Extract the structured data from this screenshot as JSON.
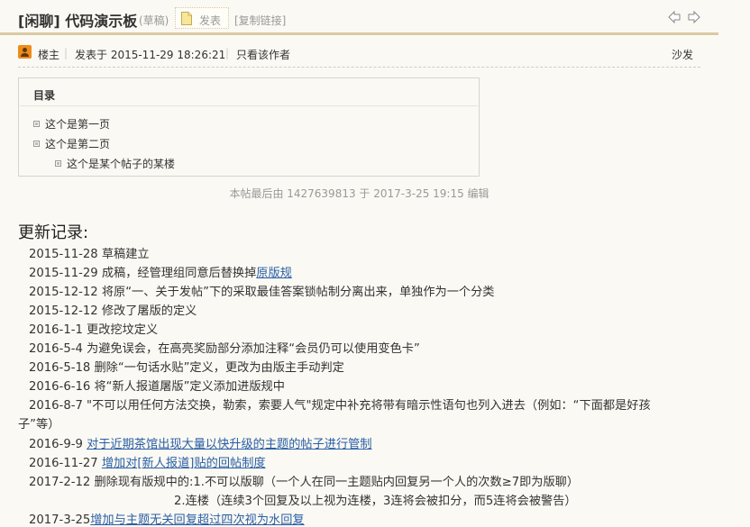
{
  "thread": {
    "title": "[闲聊] 代码演示板",
    "status": "(草稿)",
    "publish_label": "发表",
    "copy_link_label": "[复制链接]"
  },
  "post": {
    "author_role": "楼主",
    "sep": "|",
    "posted_at": "发表于 2015-11-29 18:26:21",
    "only_author": "只看该作者",
    "floor": "沙发"
  },
  "toc": {
    "title": "目录",
    "items": [
      {
        "label": "这个是第一页"
      },
      {
        "label": "这个是第二页"
      },
      {
        "label": "这个是某个帖子的某楼"
      }
    ]
  },
  "edit_note": "本帖最后由 1427639813 于 2017-3-25 19:15 编辑",
  "changelog": {
    "heading": "更新记录:",
    "lines": [
      {
        "text": "2015-11-28 草稿建立"
      },
      {
        "text": "2015-11-29 成稿，经管理组同意后替换掉",
        "link": "原版规"
      },
      {
        "text": "2015-12-12 将原“一、关于发帖”下的采取最佳答案锁帖制分离出来，单独作为一个分类"
      },
      {
        "text": "2015-12-12 修改了屠版的定义"
      },
      {
        "text": "2016-1-1 更改挖坟定义"
      },
      {
        "text": "2016-5-4 为避免误会，在高亮奖励部分添加注释“会员仍可以使用变色卡”"
      },
      {
        "text": "2016-5-18 删除“一句话水贴”定义，更改为由版主手动判定"
      },
      {
        "text": "2016-6-16 将“新人报道屠版”定义添加进版规中"
      },
      {
        "text": "2016-8-7 \"不可以用任何方法交换，勒索，索要人气\"规定中补充将带有暗示性语句也列入进去（例如：“下面都是好孩"
      },
      {
        "text": "子”等）"
      },
      {
        "text": "2016-9-9 ",
        "link": "对于近期茶馆出现大量以快升级的主题的帖子进行管制"
      },
      {
        "text": "2016-11-27 ",
        "link": "增加对[新人报道]贴的回帖制度"
      },
      {
        "text": "2017-2-12 删除现有版规中的:1.不可以版聊（一个人在同一主题贴内回复另一个人的次数≥7即为版聊）"
      },
      {
        "text": "2.连楼（连续3个回复及以上视为连楼，3连将会被扣分，而5连将会被警告）"
      },
      {
        "text": "2017-3-25",
        "link": "增加与主题无关回复超过四次视为水回复"
      }
    ]
  }
}
